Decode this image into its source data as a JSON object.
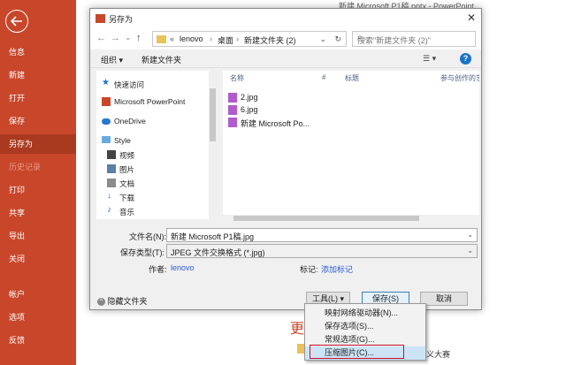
{
  "ppt": {
    "window_title": "新建 Microsoft P1稿.pptx - PowerPoint",
    "menu": [
      {
        "label": "信息"
      },
      {
        "label": "新建"
      },
      {
        "label": "打开"
      },
      {
        "label": "保存"
      },
      {
        "label": "另存为"
      },
      {
        "label": "历史记录"
      },
      {
        "label": "打印"
      },
      {
        "label": "共享"
      },
      {
        "label": "导出"
      },
      {
        "label": "关闭"
      },
      {
        "label": "帐户"
      },
      {
        "label": "选项"
      },
      {
        "label": "反馈"
      }
    ],
    "bg_heading": "更",
    "bg_text": "义大赛"
  },
  "dialog": {
    "title": "另存为",
    "close": "✕",
    "nav": {
      "back": "←",
      "forward": "→",
      "up_dd": "⌄",
      "up": "↑"
    },
    "address": {
      "prefix": "«",
      "part1": "lenovo",
      "sep1": "›",
      "part2": "桌面",
      "sep2": "›",
      "part3": "新建文件夹 (2)",
      "dd": "⌄",
      "refresh": "↻"
    },
    "search_placeholder": "搜索\"新建文件夹 (2)\"",
    "search_icon": "⌕",
    "toolbar": {
      "organize": "组织 ▾",
      "new_folder": "新建文件夹",
      "view": "☰ ▾",
      "help": "?"
    },
    "nav_pane": [
      {
        "label": "快速访问",
        "icon": "star-icon"
      },
      {
        "label": "Microsoft PowerPoint",
        "icon": "powerpoint-icon"
      },
      {
        "label": "OneDrive",
        "icon": "cloud-icon"
      },
      {
        "label": "Style",
        "icon": "computer-icon"
      },
      {
        "label": "视频",
        "icon": "video-icon"
      },
      {
        "label": "图片",
        "icon": "picture-icon"
      },
      {
        "label": "文档",
        "icon": "document-icon"
      },
      {
        "label": "下载",
        "icon": "download-icon"
      },
      {
        "label": "音乐",
        "icon": "music-icon"
      }
    ],
    "columns": {
      "name": "名称",
      "number": "#",
      "title": "标题",
      "artist": "参与创作的艺"
    },
    "files": [
      {
        "name": "2.jpg"
      },
      {
        "name": "6.jpg"
      },
      {
        "name": "新建 Microsoft Po..."
      }
    ],
    "filename_label": "文件名(N):",
    "filename_value": "新建 Microsoft P1稿.jpg",
    "filetype_label": "保存类型(T):",
    "filetype_value": "JPEG 文件交换格式 (*.jpg)",
    "author_label": "作者:",
    "author_value": "lenovo",
    "tags_label": "标记:",
    "tags_value": "添加标记",
    "hide_folders": "隐藏文件夹",
    "tools_button": "工具(L)",
    "save_button": "保存(S)",
    "cancel_button": "取消",
    "tools_menu": [
      {
        "label": "映射网络驱动器(N)..."
      },
      {
        "label": "保存选项(S)..."
      },
      {
        "label": "常规选项(G)..."
      },
      {
        "label": "压缩图片(C)..."
      }
    ]
  }
}
